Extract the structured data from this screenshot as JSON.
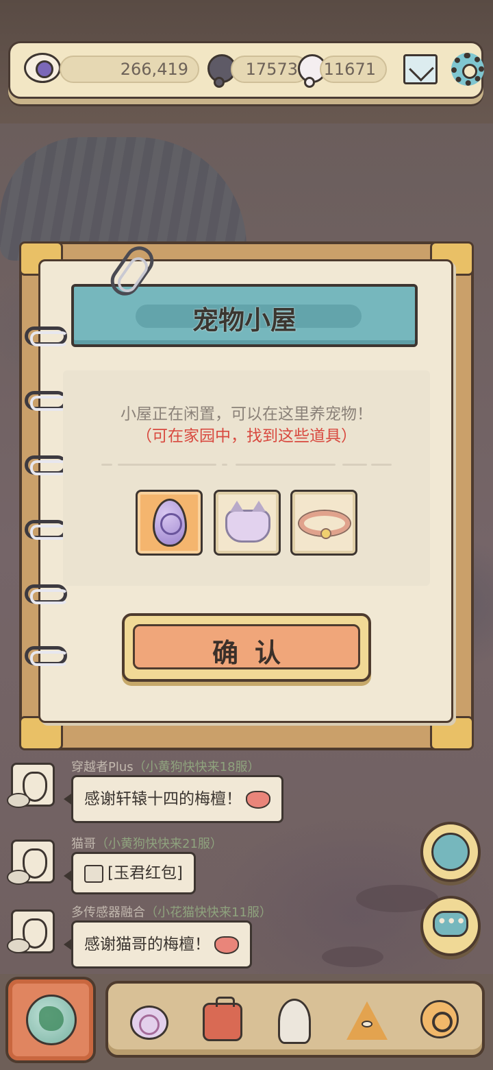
{
  "currency": {
    "eye_value": "266,419",
    "bubble_dark_value": "17573",
    "bubble_light_value": "11671"
  },
  "dialog": {
    "title": "宠物小屋",
    "description": "小屋正在闲置，可以在这里养宠物！",
    "hint": "（可在家园中，找到这些道具）",
    "items": [
      {
        "icon": "egg-icon",
        "selected": true
      },
      {
        "icon": "pet-bowl-icon",
        "selected": false
      },
      {
        "icon": "collar-icon",
        "selected": false
      }
    ],
    "confirm_label": "确认"
  },
  "chat": [
    {
      "user": "穿越者Plus",
      "server": "（小黄狗快快来18服）",
      "message": "感谢轩辕十四的梅檀！"
    },
    {
      "user": "猫哥",
      "server": "（小黄狗快快来21服）",
      "message": "[玉君红包]"
    },
    {
      "user": "多传感器融合",
      "server": "（小花猫快快来11服）",
      "message": "感谢猫哥的梅檀！"
    }
  ],
  "colors": {
    "accent_teal": "#76b7bd",
    "confirm_orange": "#f0a67a",
    "hint_red": "#d8493f",
    "paper": "#f1e8d4"
  }
}
